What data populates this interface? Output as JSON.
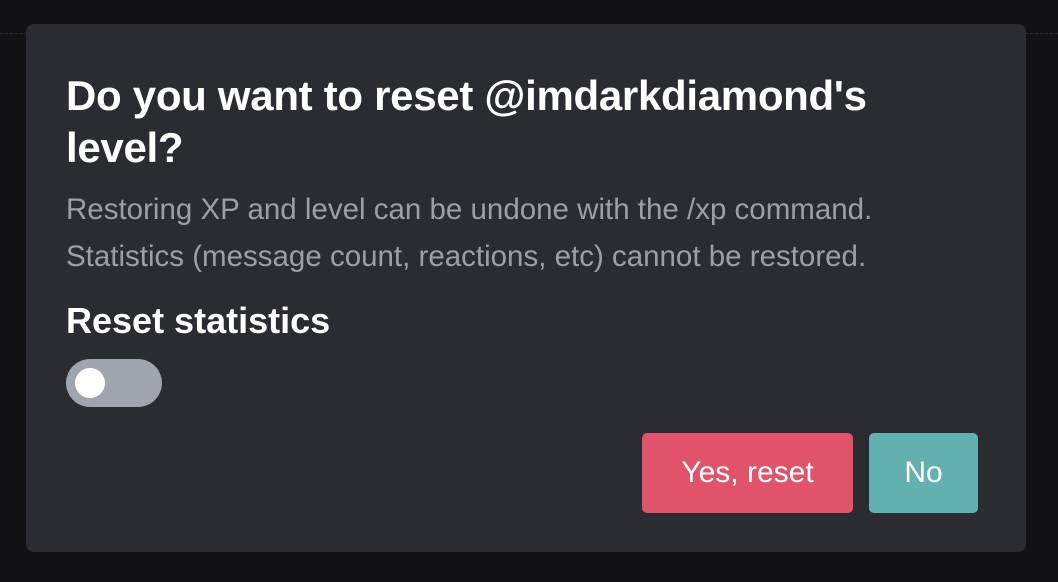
{
  "dialog": {
    "title": "Do you want to reset @imdarkdiamond's level?",
    "description_lines": [
      "Restoring XP and level can be undone with the /xp command.",
      "Statistics (message count, reactions, etc) cannot be restored."
    ],
    "toggle": {
      "label": "Reset statistics",
      "checked": false
    },
    "buttons": {
      "confirm_label": "Yes, reset",
      "cancel_label": "No"
    }
  },
  "colors": {
    "backdrop": "#121214",
    "modal_background": "#2b2c31",
    "title_text": "#ffffff",
    "description_text": "#9aa0a8",
    "toggle_off": "#9ea5ae",
    "confirm_button": "#e1526b",
    "cancel_button": "#63b0b0"
  }
}
